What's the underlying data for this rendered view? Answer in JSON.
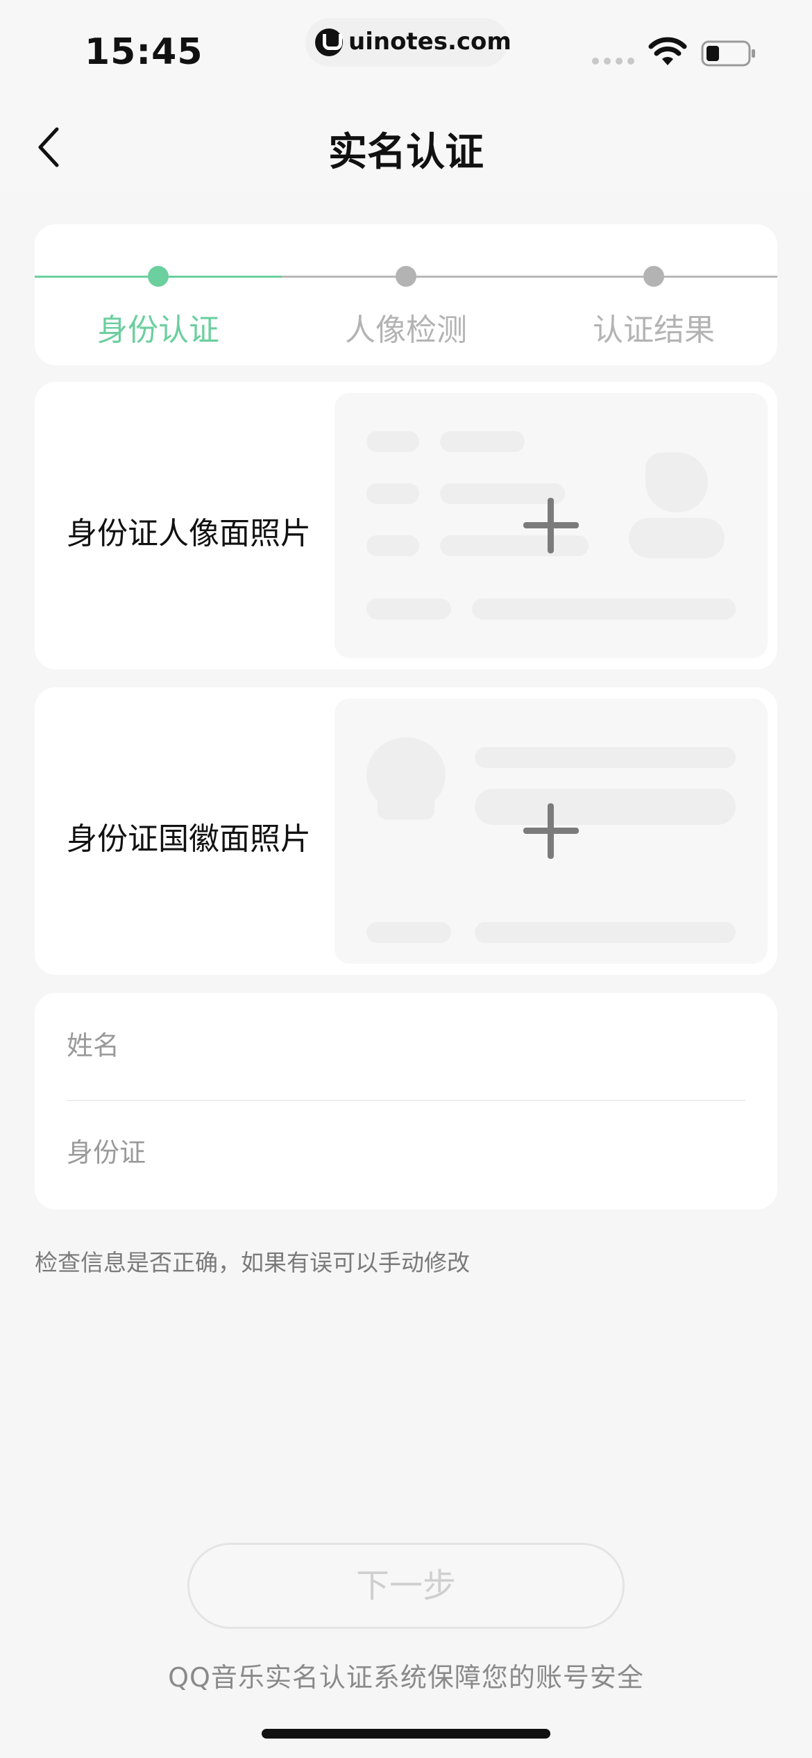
{
  "status_bar": {
    "time": "15:45",
    "url": "uinotes.com"
  },
  "nav": {
    "title": "实名认证",
    "back_icon": "chevron-left-icon"
  },
  "steps": [
    {
      "label": "身份认证",
      "state": "active"
    },
    {
      "label": "人像检测",
      "state": "inactive"
    },
    {
      "label": "认证结果",
      "state": "inactive"
    }
  ],
  "uploads": {
    "front_label": "身份证人像面照片",
    "back_label": "身份证国徽面照片"
  },
  "form": {
    "name_placeholder": "姓名",
    "id_placeholder": "身份证"
  },
  "hint": "检查信息是否正确，如果有误可以手动修改",
  "next_button_label": "下一步",
  "security_note": "QQ音乐实名认证系统保障您的账号安全",
  "colors": {
    "accent": "#6bcf9e",
    "inactive": "#b3b3b3",
    "background": "#f6f6f6",
    "card": "#ffffff"
  }
}
